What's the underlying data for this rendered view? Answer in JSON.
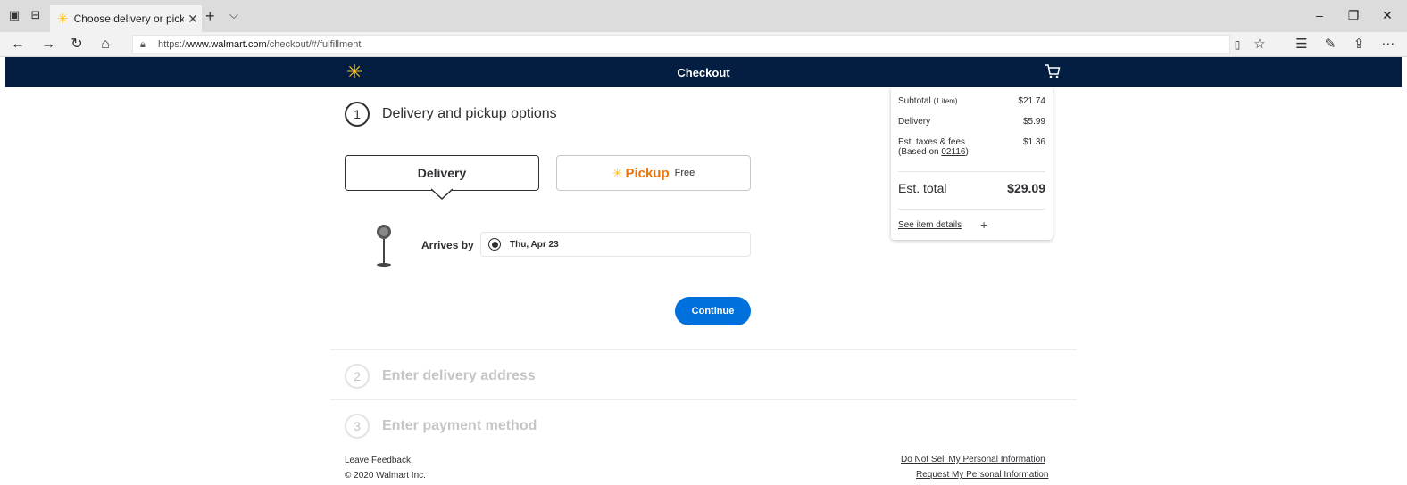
{
  "browser": {
    "tab_title": "Choose delivery or pick",
    "url_prefix": "https://",
    "url_host": "www.walmart.com",
    "url_path": "/checkout/#/fulfillment"
  },
  "header": {
    "title": "Checkout"
  },
  "step1": {
    "number": "1",
    "title": "Delivery and pickup options",
    "delivery_label": "Delivery",
    "pickup_label": "Pickup",
    "pickup_price": "Free",
    "arrives_label": "Arrives by",
    "arrival_date": "Thu, Apr 23",
    "continue_label": "Continue"
  },
  "step2": {
    "number": "2",
    "title": "Enter delivery address"
  },
  "step3": {
    "number": "3",
    "title": "Enter payment method"
  },
  "summary": {
    "subtotal_label": "Subtotal",
    "subtotal_count": "(1 item)",
    "subtotal_value": "$21.74",
    "delivery_label": "Delivery",
    "delivery_value": "$5.99",
    "taxes_label": "Est. taxes & fees",
    "taxes_based_prefix": "(Based on",
    "taxes_zip": "02116",
    "taxes_based_suffix": ")",
    "taxes_value": "$1.36",
    "total_label": "Est. total",
    "total_value": "$29.09",
    "details_link": "See item details"
  },
  "footer": {
    "feedback": "Leave Feedback",
    "copyright": "© 2020 Walmart Inc.",
    "do_not_sell": "Do Not Sell My Personal Information",
    "request_info": "Request My Personal Information"
  },
  "colors": {
    "header_bg": "#041e42",
    "spark": "#ffc220",
    "primary": "#0071dc",
    "pickup": "#e8750c"
  }
}
